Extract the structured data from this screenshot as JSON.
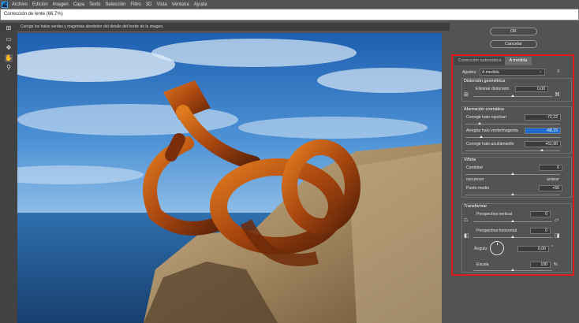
{
  "menu": {
    "items": [
      "Archivo",
      "Edición",
      "Imagen",
      "Capa",
      "Texto",
      "Selección",
      "Filtro",
      "3D",
      "Vista",
      "Ventana",
      "Ayuda"
    ],
    "logo": "Ps"
  },
  "dialog": {
    "title": "Corrección de lente (66,7%)",
    "hint": "Corrige los halos verdes y magentas alrededor del detalle del borde de la imagen."
  },
  "buttons": {
    "ok": "OK",
    "cancel": "Cancelar"
  },
  "tabs": {
    "auto": "Corrección automática",
    "custom": "A medida"
  },
  "settings": {
    "label": "Ajustes:",
    "value": "A medida"
  },
  "geometric": {
    "title": "Distorsión geométrica",
    "remove_label": "Eliminar distorsión",
    "remove_value": "0,00"
  },
  "chromatic": {
    "title": "Aberración cromática",
    "red_cyan_label": "Corregir halo rojo/cian",
    "red_cyan_value": "-72,22",
    "green_magenta_label": "Arreglar halo verde/magenta",
    "green_magenta_value": "-68,15",
    "blue_yellow_label": "Corregir halo azul/amarillo",
    "blue_yellow_value": "+61,90"
  },
  "vignette": {
    "title": "Viñeta",
    "amount_label": "Cantidad",
    "amount_value": "0",
    "darken_label": "oscurecer",
    "lighten_label": "aclarar",
    "midpoint_label": "Punto medio",
    "midpoint_value": "+50"
  },
  "transform": {
    "title": "Transformar",
    "vertical_label": "Perspectiva vertical",
    "vertical_value": "0",
    "horizontal_label": "Perspectiva horizontal",
    "horizontal_value": "0",
    "angle_label": "Ángulo:",
    "angle_value": "0,00",
    "angle_unit": "°",
    "scale_label": "Escala",
    "scale_value": "100",
    "scale_unit": "%"
  },
  "colors": {
    "highlight": "#e21c1c",
    "selected_field": "#1d6ccf"
  }
}
